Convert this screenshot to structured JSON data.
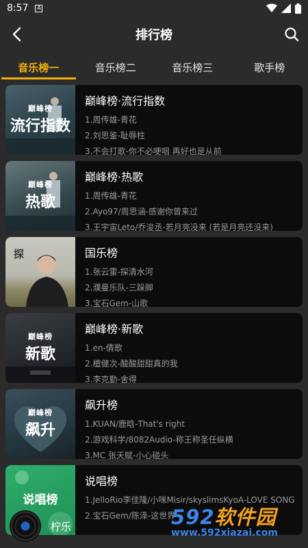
{
  "status_bar": {
    "time": "8:57",
    "notif": "A"
  },
  "header": {
    "title": "排行榜"
  },
  "tabs": [
    "音乐榜一",
    "音乐榜二",
    "音乐榜三",
    "歌手榜"
  ],
  "charts": [
    {
      "title": "巅峰榜·流行指数",
      "cover_tag": "巅峰榜",
      "cover_text": "流行指数",
      "songs": [
        "1.周传雄-青花",
        "2.刘思鉴-耻辱柱",
        "3.不会打歌-你不必哽咽 再好也是从前"
      ]
    },
    {
      "title": "巅峰榜·热歌",
      "cover_tag": "巅峰榜",
      "cover_text": "热歌",
      "songs": [
        "1.周传雄-青花",
        "2.Ayo97/周思涵-感谢你曾来过",
        "3.王宇宙Leto/乔浚丞-若月亮没来 (若是月亮还没来)"
      ]
    },
    {
      "title": "国乐榜",
      "cover_tag": "",
      "cover_text": "",
      "songs": [
        "1.张云雷-探清水河",
        "2.濮曼乐队-三跺脚",
        "3.宝石Gem-山歌"
      ]
    },
    {
      "title": "巅峰榜·新歌",
      "cover_tag": "巅峰榜",
      "cover_text": "新歌",
      "songs": [
        "1.en-倩歌",
        "2.檀健次-酸酸甜甜真的我",
        "3.李克勤-舍得"
      ]
    },
    {
      "title": "飙升榜",
      "cover_tag": "巅峰榜",
      "cover_text": "飙升",
      "songs": [
        "1.KUAN/鹿晗-That's right",
        "2.游戏科学/8082Audio-称王称圣任纵横",
        "3.MC 张天赋-小心碰头"
      ]
    },
    {
      "title": "说唱榜",
      "cover_tag": "",
      "cover_text": "说唱榜",
      "songs": [
        "1.JelloRio李佳隆/小咪Misir/skyslimsKyoA-LOVE SONG",
        "2.宝石Gem/陈泽-这世界"
      ]
    }
  ],
  "player": {
    "name": "柠乐"
  },
  "watermark": {
    "num": "592",
    "soft": "软件园",
    "url": "www.592xiazai.com"
  },
  "colors": {
    "accent": "#f2b10a",
    "background": "#2b2b2b",
    "card": "#0c0c0c"
  }
}
